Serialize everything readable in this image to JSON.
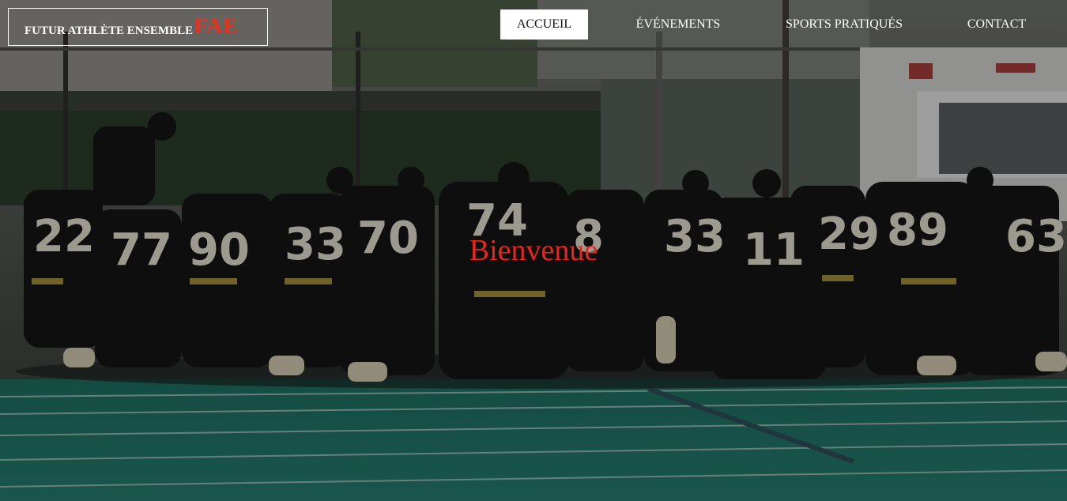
{
  "logo": {
    "text": "FUTUR ATHLÈTE ENSEMBLE",
    "accent": "FAE",
    "accent_color": "#e8321e"
  },
  "nav": {
    "items": [
      {
        "label": "ACCUEIL",
        "active": true
      },
      {
        "label": "ÉVÉNEMENTS",
        "active": false
      },
      {
        "label": "SPORTS PRATIQUÉS",
        "active": false
      },
      {
        "label": "CONTACT",
        "active": false
      }
    ]
  },
  "hero": {
    "welcome": "Bienvenue",
    "welcome_color": "#e8261b",
    "field_color": "#1f6e5f",
    "jersey_numbers": [
      "22",
      "77",
      "90",
      "33",
      "70",
      "74",
      "8",
      "33",
      "11",
      "29",
      "89",
      "63"
    ]
  }
}
